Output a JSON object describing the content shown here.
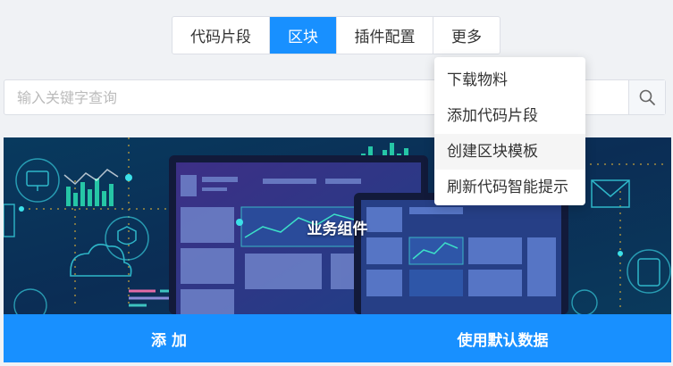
{
  "tabs": [
    {
      "label": "代码片段",
      "active": false
    },
    {
      "label": "区块",
      "active": true
    },
    {
      "label": "插件配置",
      "active": false
    },
    {
      "label": "更多",
      "active": false
    }
  ],
  "search": {
    "placeholder": "输入关键字查询",
    "value": "",
    "icon": "search-icon"
  },
  "dropdown": {
    "items": [
      "下载物料",
      "添加代码片段",
      "创建区块模板",
      "刷新代码智能提示"
    ],
    "hovered_index": 2
  },
  "card": {
    "title": "业务组件"
  },
  "actions": {
    "add_label": "添 加",
    "default_label": "使用默认数据"
  },
  "colors": {
    "primary": "#1890ff",
    "page_bg": "#f0f2f5",
    "card_bg": "#062a4d"
  }
}
